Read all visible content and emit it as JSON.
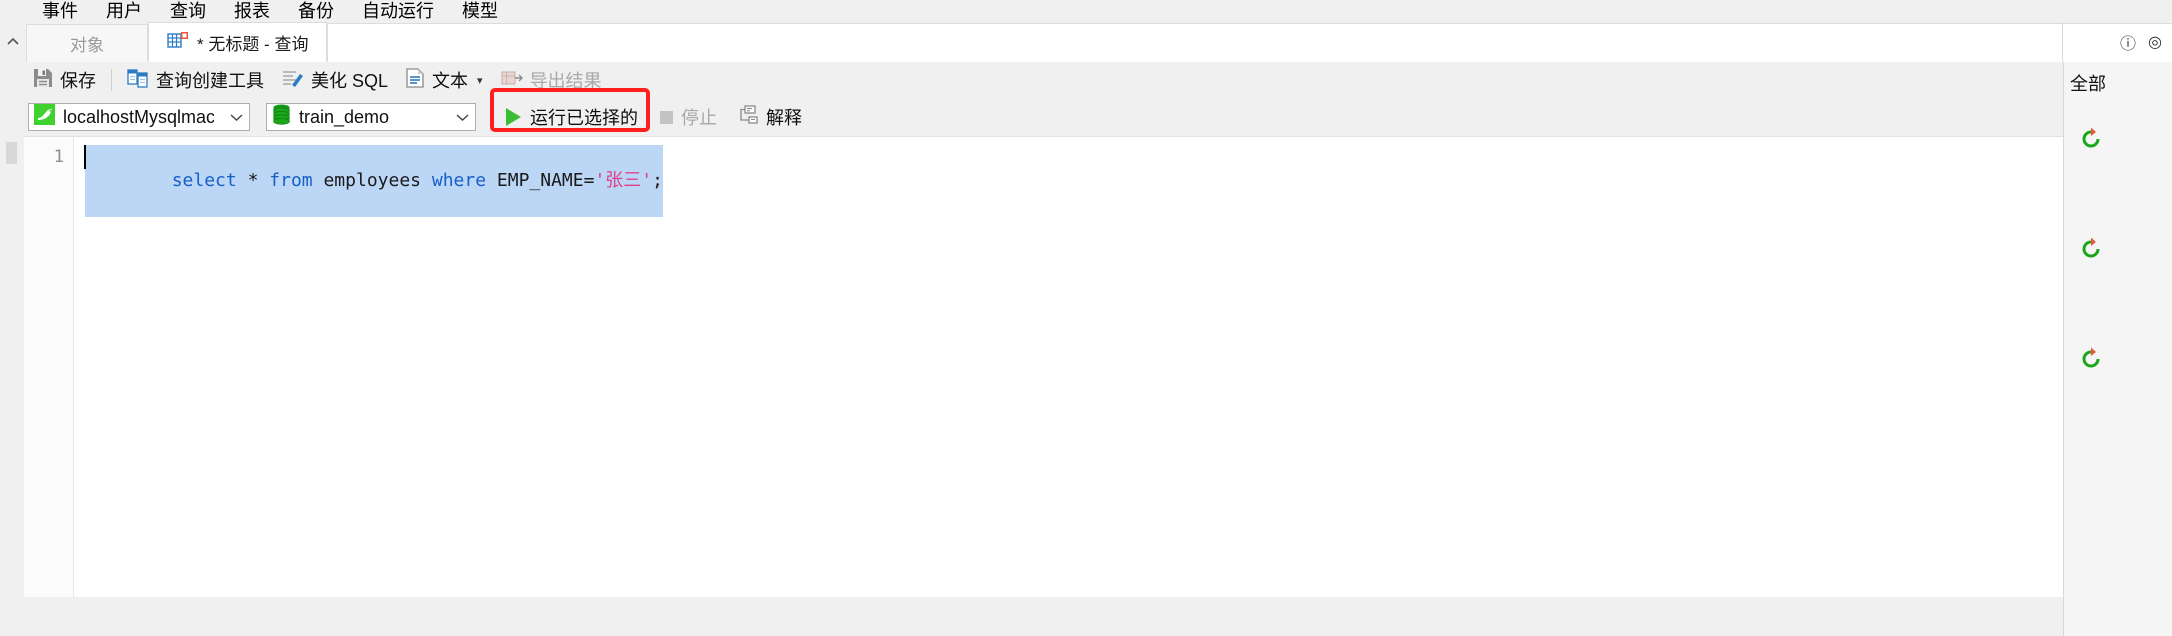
{
  "menubar": {
    "items": [
      {
        "label": "事件"
      },
      {
        "label": "用户"
      },
      {
        "label": "查询"
      },
      {
        "label": "报表"
      },
      {
        "label": "备份"
      },
      {
        "label": "自动运行"
      },
      {
        "label": "模型"
      }
    ]
  },
  "tabstrip": {
    "collapse_icon": "chevron-up-icon",
    "tabs": [
      {
        "label": "对象",
        "active": false,
        "icon": ""
      },
      {
        "label": "* 无标题 - 查询",
        "active": true,
        "icon": "query-table-icon"
      }
    ],
    "right_icons": [
      {
        "name": "info-icon",
        "glyph": "ⓘ"
      },
      {
        "name": "globe-icon",
        "glyph": "◎"
      }
    ]
  },
  "toolbar": {
    "buttons": [
      {
        "label": "保存",
        "icon": "save-icon"
      },
      {
        "label": "查询创建工具",
        "icon": "query-builder-icon"
      },
      {
        "label": "美化 SQL",
        "icon": "beautify-sql-icon"
      },
      {
        "label": "文本",
        "icon": "text-icon",
        "caret": "▾"
      },
      {
        "label": "导出结果",
        "icon": "export-results-icon"
      }
    ]
  },
  "connbar": {
    "connection": {
      "value": "localhostMysqlmac",
      "icon": "mysql-dolphin-icon",
      "caret": "⌄"
    },
    "database": {
      "value": "train_demo",
      "icon": "database-icon",
      "caret": "⌄"
    },
    "run_selected": {
      "label": "运行已选择的",
      "icon": "play-icon",
      "highlighted": true,
      "highlight_color": "#ff1f1f"
    },
    "stop": {
      "label": "停止",
      "icon": "stop-icon",
      "disabled": true
    },
    "explain": {
      "label": "解释",
      "icon": "explain-icon"
    }
  },
  "editor": {
    "line_numbers": [
      "1"
    ],
    "sql": {
      "full_text": "select * from employees where EMP_NAME='张三';",
      "tokens": [
        {
          "t": "select",
          "type": "keyword"
        },
        {
          "t": " ",
          "type": "plain"
        },
        {
          "t": "*",
          "type": "operator"
        },
        {
          "t": " ",
          "type": "plain"
        },
        {
          "t": "from",
          "type": "keyword"
        },
        {
          "t": " ",
          "type": "plain"
        },
        {
          "t": "employees",
          "type": "identifier"
        },
        {
          "t": " ",
          "type": "plain"
        },
        {
          "t": "where",
          "type": "keyword"
        },
        {
          "t": " ",
          "type": "plain"
        },
        {
          "t": "EMP_NAME=",
          "type": "identifier"
        },
        {
          "t": "'张三'",
          "type": "string"
        },
        {
          "t": ";",
          "type": "operator"
        }
      ],
      "selected": true,
      "selection_color": "#bcd6f5"
    }
  },
  "rightpanel": {
    "title": "全部",
    "icons": [
      {
        "name": "refresh-icon"
      },
      {
        "name": "refresh-icon"
      },
      {
        "name": "refresh-icon"
      }
    ]
  },
  "colors": {
    "accent_green": "#3bbd34",
    "highlight_red": "#ff1f1f",
    "keyword_blue": "#1560c7",
    "string_pink": "#e0408a",
    "selection_blue": "#bcd6f5",
    "chrome_gray": "#f0f0f0"
  }
}
